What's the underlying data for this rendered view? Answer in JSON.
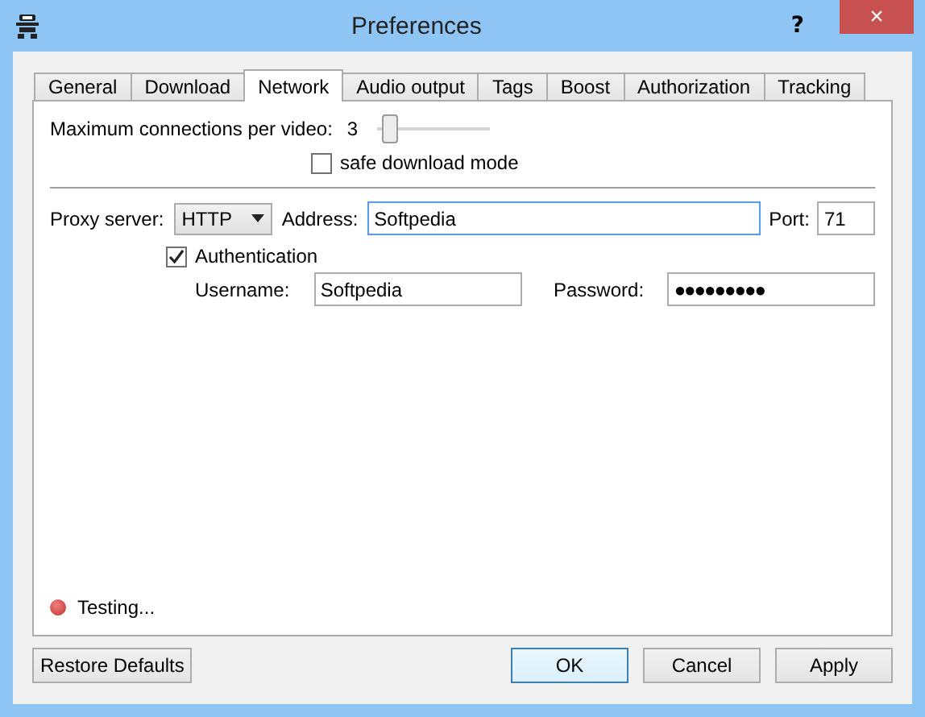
{
  "window": {
    "title": "Preferences",
    "help": "?",
    "close": "×"
  },
  "tabs": [
    {
      "label": "General",
      "selected": false
    },
    {
      "label": "Download",
      "selected": false
    },
    {
      "label": "Network",
      "selected": true
    },
    {
      "label": "Audio output",
      "selected": false
    },
    {
      "label": "Tags",
      "selected": false
    },
    {
      "label": "Boost",
      "selected": false
    },
    {
      "label": "Authorization",
      "selected": false
    },
    {
      "label": "Tracking",
      "selected": false
    }
  ],
  "connections": {
    "label": "Maximum connections per video:",
    "value": "3",
    "level": 0.05
  },
  "safe_mode": {
    "label": "safe download mode",
    "checked": false
  },
  "proxy": {
    "label": "Proxy server:",
    "type": "HTTP",
    "address_label": "Address:",
    "address": "Softpedia",
    "port_label": "Port:",
    "port": "71"
  },
  "authentication": {
    "label": "Authentication",
    "checked": true,
    "username_label": "Username:",
    "username": "Softpedia",
    "password_label": "Password:",
    "password": "●●●●●●●●●"
  },
  "status": {
    "text": "Testing..."
  },
  "buttons": {
    "restore": "Restore Defaults",
    "ok": "OK",
    "cancel": "Cancel",
    "apply": "Apply"
  }
}
